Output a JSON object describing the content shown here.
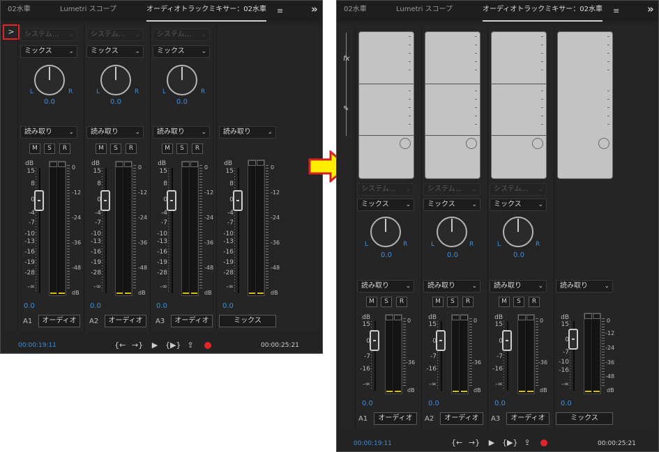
{
  "left_panel": {
    "tab_sequence": "02水車",
    "tab_lumetri": "Lumetri スコープ",
    "tab_mixer": "オーディオトラックミキサー：02水車",
    "menu_glyph": "≡",
    "overflow_glyph": "»",
    "expand_glyph": ">",
    "timecode_left": "00:00:19:11",
    "timecode_right": "00:00:25:21"
  },
  "right_panel": {
    "tab_sequence": "02水車",
    "tab_lumetri": "Lumetri スコープ",
    "tab_mixer": "オーディオトラックミキサー：02水車",
    "menu_glyph": "≡",
    "overflow_glyph": "»",
    "fx_label": "fx",
    "send_label": "✎",
    "timecode_left": "00:00:19:11",
    "timecode_right": "00:00:25:21"
  },
  "tracks": [
    {
      "id": "A1",
      "name": "オーディオ",
      "input": "システム...",
      "mode": "ミックス",
      "automation": "読み取り",
      "pan": "0.0",
      "volume": "0.0"
    },
    {
      "id": "A2",
      "name": "オーディオ",
      "input": "システム...",
      "mode": "ミックス",
      "automation": "読み取り",
      "pan": "0.0",
      "volume": "0.0"
    },
    {
      "id": "A3",
      "name": "オーディオ",
      "input": "システム...",
      "mode": "ミックス",
      "automation": "読み取り",
      "pan": "0.0",
      "volume": "0.0"
    }
  ],
  "master": {
    "name": "ミックス",
    "automation": "読み取り",
    "volume": "0.0"
  },
  "buttons": {
    "mute": "M",
    "solo": "S",
    "record": "R",
    "pan_left": "L",
    "pan_right": "R"
  },
  "fader_scale": {
    "left_full": [
      "dB",
      "15",
      "8",
      "0",
      "-4",
      "-7",
      "-10",
      "-13",
      "-16",
      "-19",
      "-28",
      "-∞"
    ],
    "right_compact": [
      "dB",
      "15",
      "0",
      "-7",
      "-16",
      "-∞"
    ],
    "master_compact": [
      "dB",
      "15",
      "0",
      "-7",
      "-10",
      "-16",
      "-∞"
    ],
    "master_full": [
      "dB",
      "15",
      "8",
      "0",
      "-4",
      "-7",
      "-10",
      "-13",
      "-16",
      "-19",
      "-28",
      "-∞"
    ]
  },
  "meter_scale": {
    "full": [
      "0",
      "-12",
      "-24",
      "-36",
      "-48",
      "dB"
    ],
    "compact": [
      "0",
      "-36",
      "dB"
    ],
    "master_compact": [
      "0",
      "-12",
      "-24",
      "-36",
      "-48",
      "dB"
    ]
  },
  "transport": {
    "go_in": "{←",
    "go_out": "→}",
    "play": "▶",
    "loop": "{▶}",
    "export": "⇪"
  },
  "colors": {
    "accent_blue": "#3d8ee0",
    "record_red": "#e0262a",
    "meter_yellow": "#d8c200",
    "arrow_yellow": "#ffee00"
  }
}
